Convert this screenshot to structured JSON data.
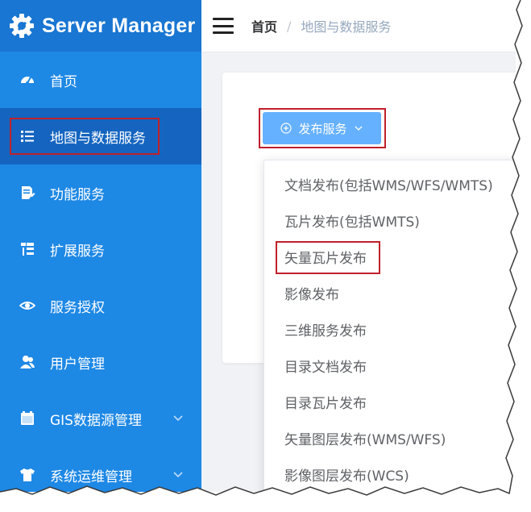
{
  "brand": {
    "title": "Server Manager",
    "icon": "gear-icon"
  },
  "sidebar": {
    "items": [
      {
        "label": "首页",
        "icon": "dashboard-icon"
      },
      {
        "label": "地图与数据服务",
        "icon": "list-icon",
        "active": true,
        "highlighted": true
      },
      {
        "label": "功能服务",
        "icon": "edit-doc-icon"
      },
      {
        "label": "扩展服务",
        "icon": "tree-icon"
      },
      {
        "label": "服务授权",
        "icon": "eye-icon"
      },
      {
        "label": "用户管理",
        "icon": "users-icon"
      },
      {
        "label": "GIS数据源管理",
        "icon": "folder-icon",
        "has_submenu": true
      },
      {
        "label": "系统运维管理",
        "icon": "shirt-icon",
        "has_submenu": true
      }
    ]
  },
  "header": {
    "breadcrumb": {
      "home": "首页",
      "separator": "/",
      "current": "地图与数据服务"
    }
  },
  "main": {
    "publish_button": {
      "label": "发布服务",
      "highlighted": true
    },
    "dropdown": {
      "items": [
        "文档发布(包括WMS/WFS/WMTS)",
        "瓦片发布(包括WMTS)",
        "矢量瓦片发布",
        "影像发布",
        "三维服务发布",
        "目录文档发布",
        "目录瓦片发布",
        "矢量图层发布(WMS/WFS)",
        "影像图层发布(WCS)"
      ],
      "highlighted_item": "矢量瓦片发布"
    }
  },
  "colors": {
    "sidebar": "#1e88e5",
    "sidebar_active": "#1565c0",
    "brand_bar": "#1976d2",
    "button": "#66b1ff",
    "highlight": "#c0202a"
  }
}
